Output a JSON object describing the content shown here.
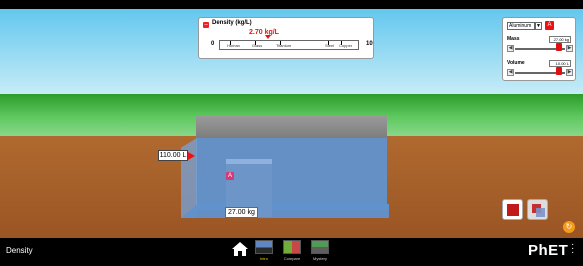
{
  "sim": {
    "title": "Density"
  },
  "density_panel": {
    "title": "Density (kg/L)",
    "value": "2.70 kg/L",
    "min": "0",
    "max": "10",
    "reference_materials": [
      "Human",
      "Glass",
      "Titanium",
      "Steel",
      "Copper"
    ]
  },
  "controls": {
    "material": "Aluminum",
    "material_badge": "A",
    "mass_label": "Mass",
    "mass_value": "27.00 kg",
    "volume_label": "Volume",
    "volume_value": "10.00 L"
  },
  "scene": {
    "volume_readout": "110.00 L",
    "block_label": "A",
    "block_mass": "27.00 kg"
  },
  "nav": {
    "tabs": [
      {
        "label": "Intro",
        "active": true
      },
      {
        "label": "Compare",
        "active": false
      },
      {
        "label": "Mystery",
        "active": false
      }
    ],
    "logo": "PhET"
  },
  "colors": {
    "accent": "#e11111",
    "water": "#6092ce",
    "ground": "#a45b27",
    "active_tab": "#f5c518"
  }
}
